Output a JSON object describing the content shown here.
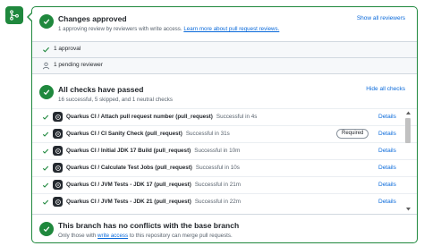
{
  "approval": {
    "title": "Changes approved",
    "subtitle": "1 approving review by reviewers with write access.",
    "learn_more": "Learn more about pull request reviews.",
    "show_all": "Show all reviewers",
    "approvals": "1 approval",
    "pending": "1 pending reviewer"
  },
  "checks": {
    "title": "All checks have passed",
    "subtitle": "16 successful, 5 skipped, and 1 neutral checks",
    "hide_all": "Hide all checks",
    "rows": [
      {
        "name": "Quarkus CI / Attach pull request number (pull_request)",
        "status": "Successful in 4s",
        "required": "",
        "details": "Details"
      },
      {
        "name": "Quarkus CI / CI Sanity Check (pull_request)",
        "status": "Successful in 31s",
        "required": "Required",
        "details": "Details"
      },
      {
        "name": "Quarkus CI / Initial JDK 17 Build (pull_request)",
        "status": "Successful in 10m",
        "required": "",
        "details": "Details"
      },
      {
        "name": "Quarkus CI / Calculate Test Jobs (pull_request)",
        "status": "Successful in 10s",
        "required": "",
        "details": "Details"
      },
      {
        "name": "Quarkus CI / JVM Tests - JDK 17 (pull_request)",
        "status": "Successful in 21m",
        "required": "",
        "details": "Details"
      },
      {
        "name": "Quarkus CI / JVM Tests - JDK 21 (pull_request)",
        "status": "Successful in 22m",
        "required": "",
        "details": "Details"
      }
    ]
  },
  "conflicts": {
    "title": "This branch has no conflicts with the base branch",
    "subtitle_pre": "Only those with",
    "write_access": "write access",
    "subtitle_post": "to this repository can merge pull requests."
  },
  "colors": {
    "success": "#1f883d",
    "link": "#0969da",
    "border": "#d1d9e0"
  },
  "icons": {
    "merge": "git-merge-icon",
    "check": "check-icon",
    "person": "person-icon",
    "avatar": "github-actions-icon"
  }
}
